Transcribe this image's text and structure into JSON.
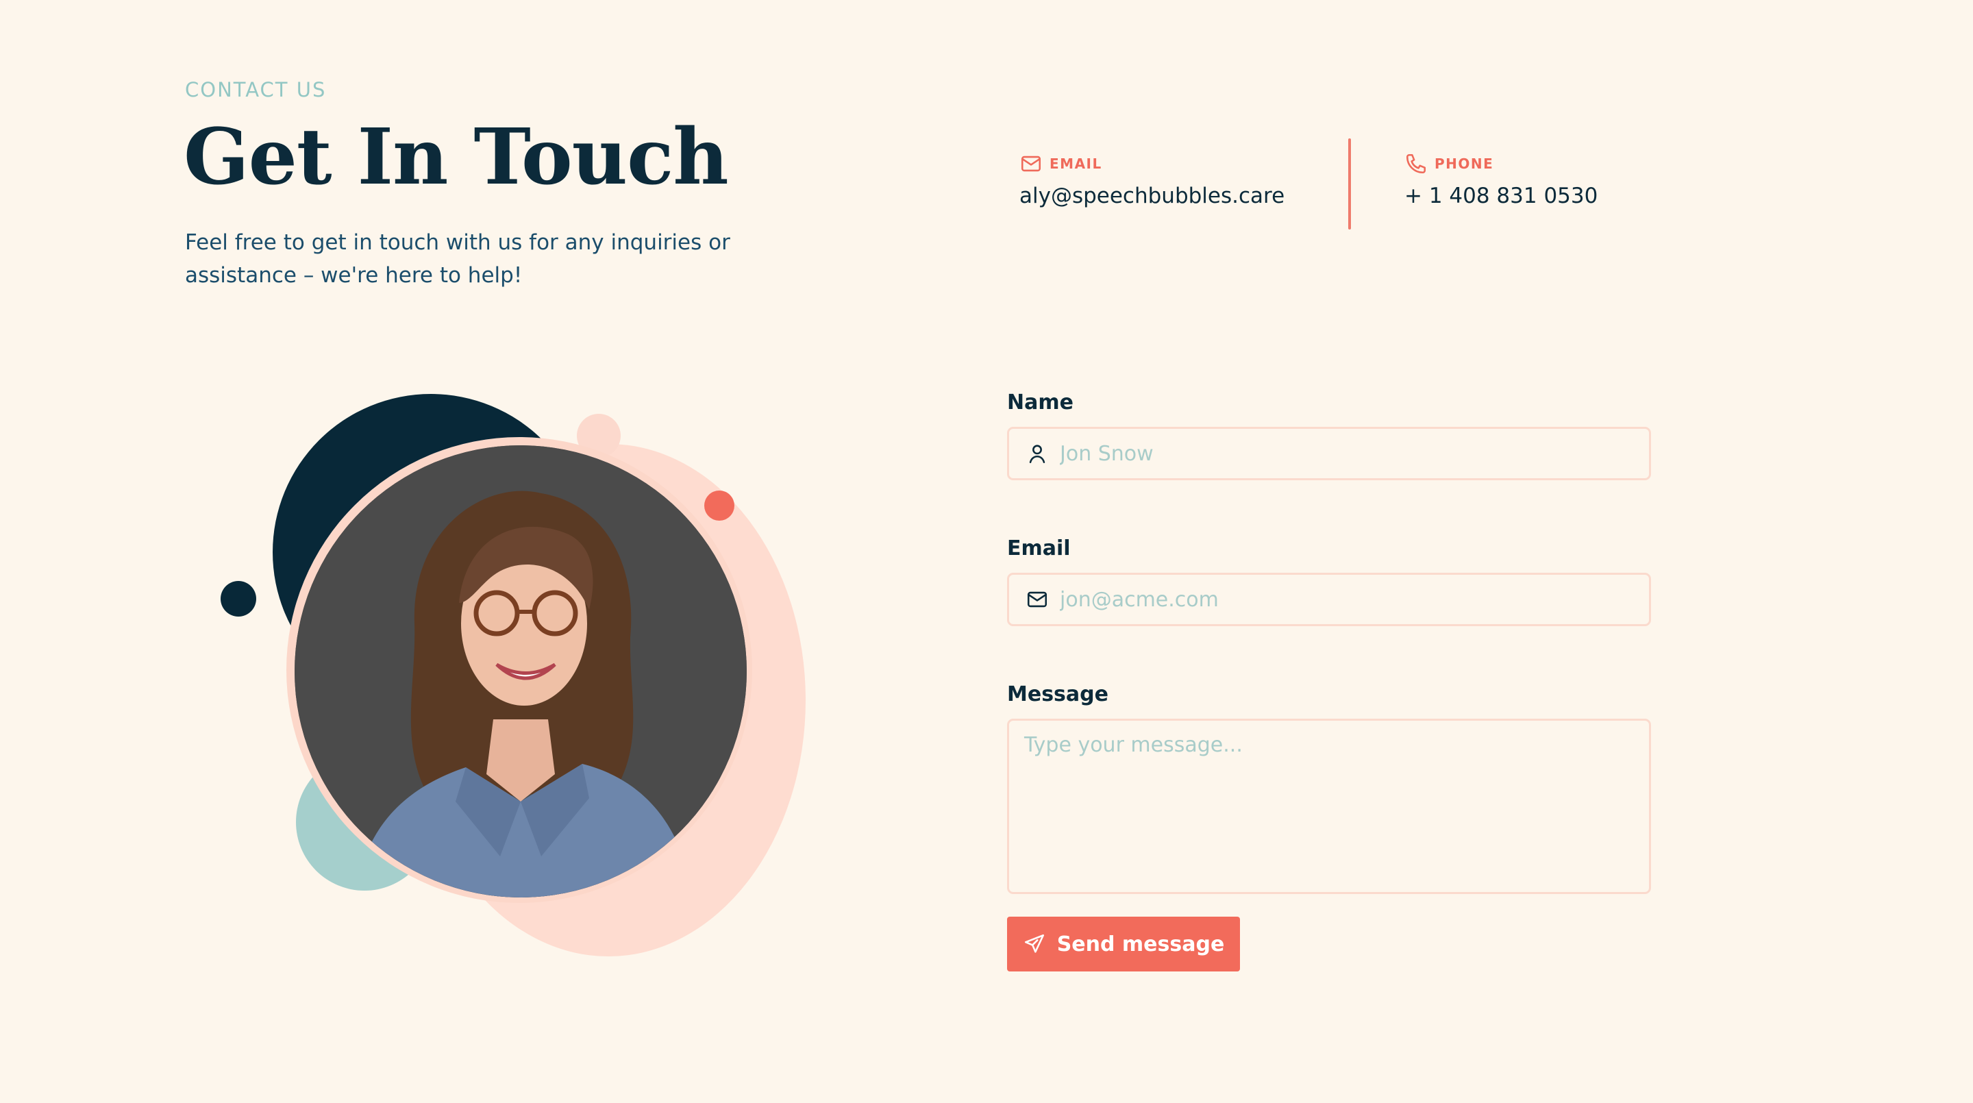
{
  "header": {
    "eyebrow": "CONTACT US",
    "title": "Get In Touch",
    "subtitle": "Feel free to get in touch with us for any inquiries or assistance – we're here to help!"
  },
  "contact": {
    "email_label": "EMAIL",
    "email_value": "aly@speechbubbles.care",
    "phone_label": "PHONE",
    "phone_value": "+ 1 408 831 0530"
  },
  "form": {
    "name_label": "Name",
    "name_placeholder": "Jon Snow",
    "email_label": "Email",
    "email_placeholder": "jon@acme.com",
    "message_label": "Message",
    "message_placeholder": "Type your message...",
    "submit_label": "Send message"
  },
  "icons": {
    "email": "mail-icon",
    "phone": "phone-icon",
    "name_field": "user-icon",
    "email_field": "mail-icon",
    "submit": "send-icon"
  },
  "colors": {
    "background": "#fdf6ec",
    "navy": "#0c2a3a",
    "accent_coral": "#f26b5b",
    "teal": "#93c7c4",
    "peach": "#fedcd0"
  }
}
